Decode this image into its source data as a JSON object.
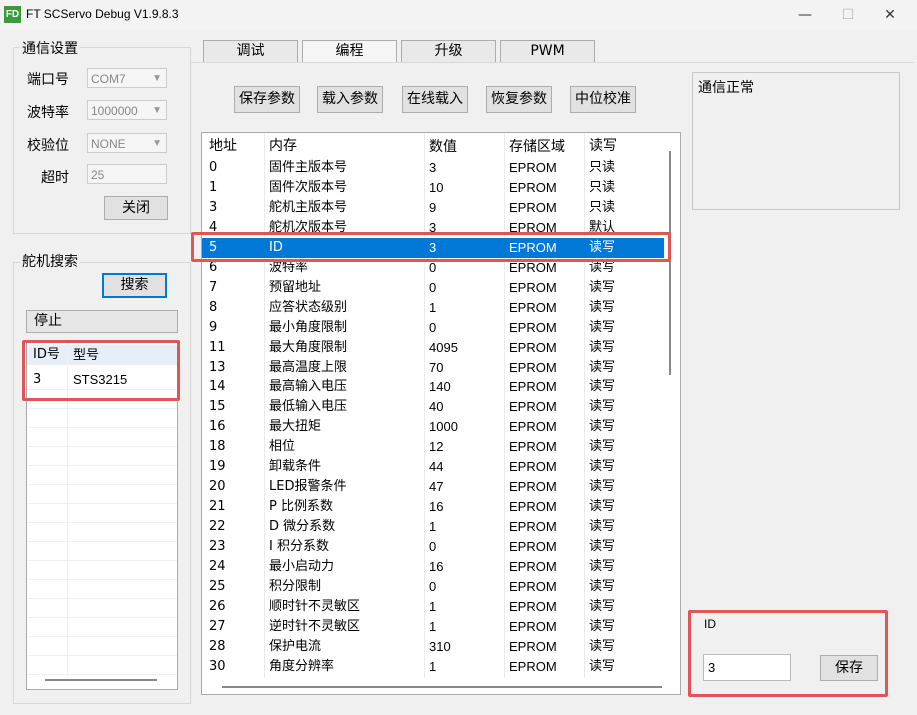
{
  "window": {
    "title": "FT SCServo Debug V1.9.8.3",
    "logo_text": "FD",
    "minimize": "—",
    "maximize": "☐",
    "close": "✕"
  },
  "comm": {
    "group_title": "通信设置",
    "port_label": "端口号",
    "port_value": "COM7",
    "baud_label": "波特率",
    "baud_value": "1000000",
    "parity_label": "校验位",
    "parity_value": "NONE",
    "timeout_label": "超时",
    "timeout_value": "25",
    "close_button": "关闭"
  },
  "search": {
    "group_title": "舵机搜索",
    "search_button": "搜索",
    "stop_button": "停止",
    "list_headers": [
      "ID号",
      "型号"
    ],
    "list_rows": [
      [
        "3",
        "STS3215"
      ]
    ]
  },
  "tabs": [
    "调试",
    "编程",
    "升级",
    "PWM"
  ],
  "toolbar": {
    "save_params": "保存参数",
    "load_params": "载入参数",
    "online_load": "在线载入",
    "restore_params": "恢复参数",
    "mid_calibrate": "中位校准"
  },
  "table": {
    "headers": [
      "地址",
      "内存",
      "数值",
      "存储区域",
      "读写"
    ],
    "selected_index": 4,
    "rows": [
      [
        "0",
        "固件主版本号",
        "3",
        "EPROM",
        "只读"
      ],
      [
        "1",
        "固件次版本号",
        "10",
        "EPROM",
        "只读"
      ],
      [
        "3",
        "舵机主版本号",
        "9",
        "EPROM",
        "只读"
      ],
      [
        "4",
        "舵机次版本号",
        "3",
        "EPROM",
        "默认"
      ],
      [
        "5",
        "ID",
        "3",
        "EPROM",
        "读写"
      ],
      [
        "6",
        "波特率",
        "0",
        "EPROM",
        "读写"
      ],
      [
        "7",
        "预留地址",
        "0",
        "EPROM",
        "读写"
      ],
      [
        "8",
        "应答状态级别",
        "1",
        "EPROM",
        "读写"
      ],
      [
        "9",
        "最小角度限制",
        "0",
        "EPROM",
        "读写"
      ],
      [
        "11",
        "最大角度限制",
        "4095",
        "EPROM",
        "读写"
      ],
      [
        "13",
        "最高温度上限",
        "70",
        "EPROM",
        "读写"
      ],
      [
        "14",
        "最高输入电压",
        "140",
        "EPROM",
        "读写"
      ],
      [
        "15",
        "最低输入电压",
        "40",
        "EPROM",
        "读写"
      ],
      [
        "16",
        "最大扭矩",
        "1000",
        "EPROM",
        "读写"
      ],
      [
        "18",
        "相位",
        "12",
        "EPROM",
        "读写"
      ],
      [
        "19",
        "卸载条件",
        "44",
        "EPROM",
        "读写"
      ],
      [
        "20",
        "LED报警条件",
        "47",
        "EPROM",
        "读写"
      ],
      [
        "21",
        "P 比例系数",
        "16",
        "EPROM",
        "读写"
      ],
      [
        "22",
        "D 微分系数",
        "1",
        "EPROM",
        "读写"
      ],
      [
        "23",
        "I 积分系数",
        "0",
        "EPROM",
        "读写"
      ],
      [
        "24",
        "最小启动力",
        "16",
        "EPROM",
        "读写"
      ],
      [
        "25",
        "积分限制",
        "0",
        "EPROM",
        "读写"
      ],
      [
        "26",
        "顺时针不灵敏区",
        "1",
        "EPROM",
        "读写"
      ],
      [
        "27",
        "逆时针不灵敏区",
        "1",
        "EPROM",
        "读写"
      ],
      [
        "28",
        "保护电流",
        "310",
        "EPROM",
        "读写"
      ],
      [
        "30",
        "角度分辨率",
        "1",
        "EPROM",
        "读写"
      ]
    ]
  },
  "status": {
    "text": "通信正常"
  },
  "edit": {
    "label": "ID",
    "value": "3",
    "save_button": "保存"
  },
  "colors": {
    "selection": "#0078d7",
    "highlight": "#e05555"
  }
}
